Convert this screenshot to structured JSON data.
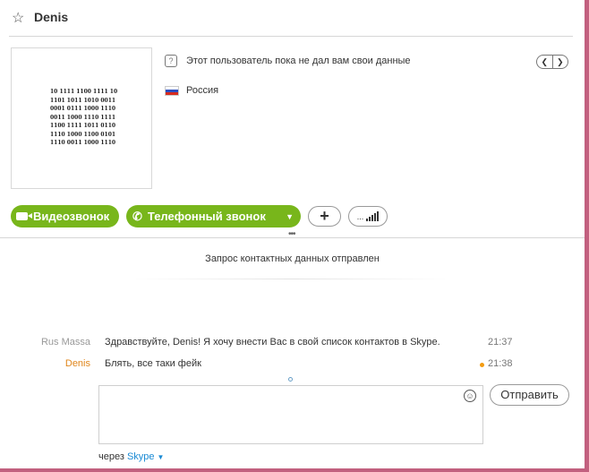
{
  "header": {
    "contact_name": "Denis"
  },
  "profile": {
    "avatar_text": [
      "10 1111 1100 1111 10",
      "1101 1011 1010 0011",
      "0001 0111 1000 1110",
      "0011 1000 1110 1111",
      "1100 1111 1011 0110",
      "1110 1000 1100 0101",
      "1110 0011 1000 1110"
    ],
    "privacy_notice": "Этот пользователь пока не дал вам свои данные",
    "country": "Россия"
  },
  "actions": {
    "video_call": "Видеозвонок",
    "phone_call": "Телефонный звонок"
  },
  "chat": {
    "status": "Запрос контактных данных отправлен",
    "messages": [
      {
        "author": "Rus Massa",
        "text": "Здравствуйте, Denis! Я хочу внести Вас в свой список контактов в Skype.",
        "time": "21:37",
        "author_color": "#999999"
      },
      {
        "author": "Denis",
        "text": "Блять, все таки фейк",
        "time": "21:38",
        "author_color": "#e0861b"
      }
    ]
  },
  "composer": {
    "send_label": "Отправить",
    "via_prefix": "через",
    "via_service": "Skype"
  },
  "colors": {
    "accent_green": "#78b61b",
    "frame": "#c2607f",
    "link_blue": "#1a8ad4"
  }
}
